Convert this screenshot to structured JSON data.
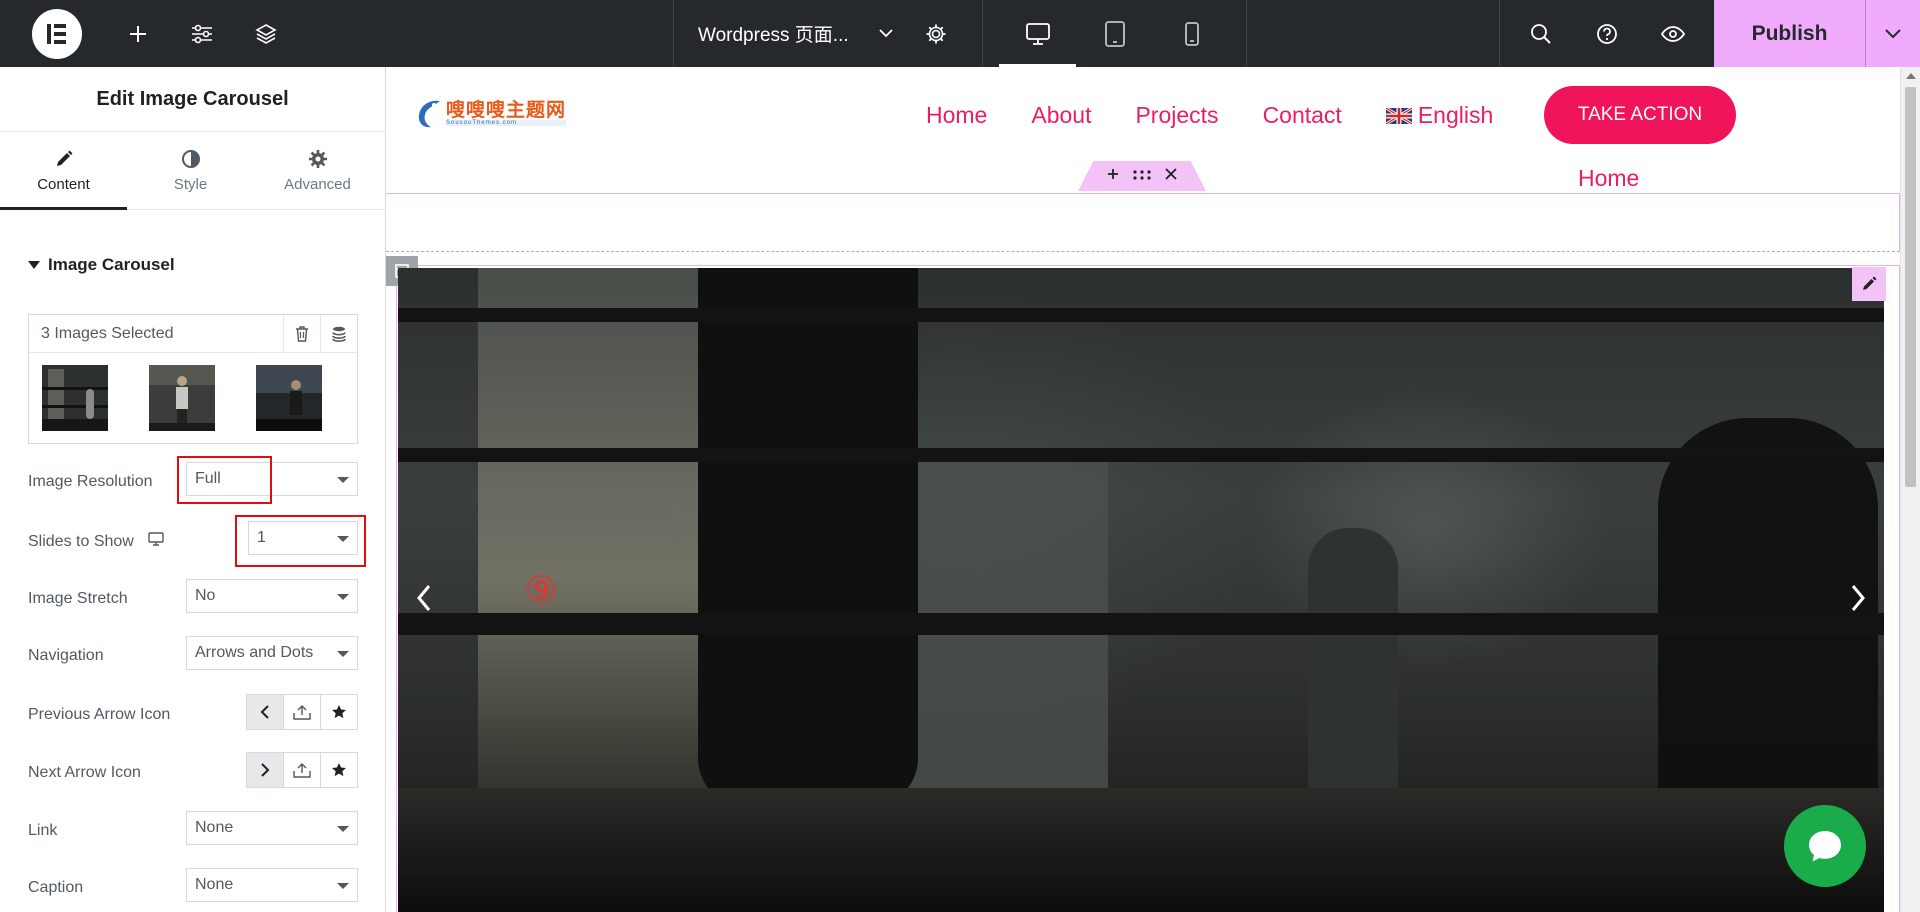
{
  "topbar": {
    "document_title": "Wordpress 页面...",
    "publish_label": "Publish"
  },
  "panel": {
    "title": "Edit Image Carousel",
    "tabs": [
      {
        "label": "Content",
        "icon": "pencil-icon"
      },
      {
        "label": "Style",
        "icon": "half-circle-icon"
      },
      {
        "label": "Advanced",
        "icon": "gear-icon"
      }
    ],
    "section_title": "Image Carousel",
    "gallery": {
      "count_label": "3 Images Selected"
    },
    "controls": {
      "image_resolution": {
        "label": "Image Resolution",
        "value": "Full"
      },
      "slides_to_show": {
        "label": "Slides to Show",
        "value": "1"
      },
      "image_stretch": {
        "label": "Image Stretch",
        "value": "No"
      },
      "navigation": {
        "label": "Navigation",
        "value": "Arrows and Dots"
      },
      "previous_arrow_icon": {
        "label": "Previous Arrow Icon"
      },
      "next_arrow_icon": {
        "label": "Next Arrow Icon"
      },
      "link": {
        "label": "Link",
        "value": "None"
      },
      "caption": {
        "label": "Caption",
        "value": "None"
      }
    }
  },
  "site": {
    "brand_name": "嗖嗖嗖主题网",
    "brand_sub": "SousouThemes.com",
    "nav": [
      "Home",
      "About",
      "Projects",
      "Contact"
    ],
    "language": "English",
    "cta_label": "TAKE ACTION",
    "submenu_home": "Home"
  },
  "carousel": {
    "marker": "⑨"
  },
  "colors": {
    "accent_pink": "#f0abfc",
    "nav_red": "#e91e63",
    "cta": "#f0145a",
    "topbar": "#26292c",
    "chat_green": "#1aab4a",
    "highlight_red": "#e10e0e"
  }
}
